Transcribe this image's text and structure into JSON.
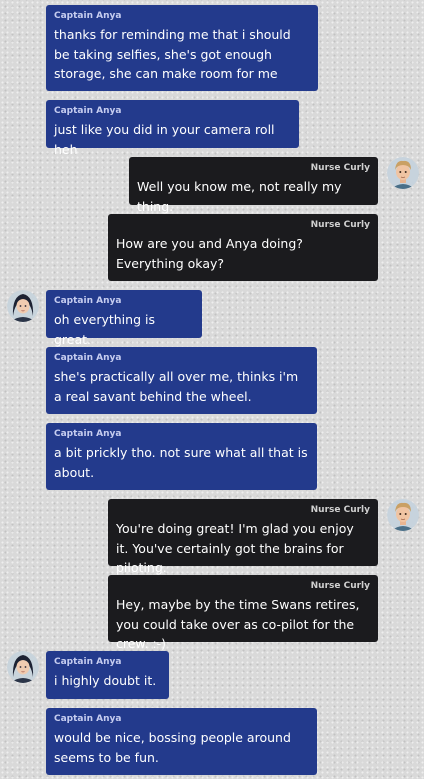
{
  "colors": {
    "anya_bubble": "#233a8c",
    "curly_bubble": "#1b1b1e",
    "background": "#d9d9d9"
  },
  "messages": [
    {
      "sender": "Captain Anya",
      "text": "thanks for reminding me that i should be taking selfies, she's got enough storage, she can make room for me"
    },
    {
      "sender": "Captain Anya",
      "text": "just like you did in your camera roll heh"
    },
    {
      "sender": "Nurse Curly",
      "text": "Well you know me, not really my thing."
    },
    {
      "sender": "Nurse Curly",
      "text": "How are you and Anya doing? Everything okay?"
    },
    {
      "sender": "Captain Anya",
      "text": "oh everything is great."
    },
    {
      "sender": "Captain Anya",
      "text": "she's practically all over me, thinks i'm a real savant behind the wheel."
    },
    {
      "sender": "Captain Anya",
      "text": "a bit prickly tho. not sure what all that is about."
    },
    {
      "sender": "Nurse Curly",
      "text": "You're doing great! I'm glad you enjoy it. You've certainly got the brains for piloting."
    },
    {
      "sender": "Nurse Curly",
      "text": "Hey, maybe by the time Swans retires, you could take over as co-pilot for the crew. :-)"
    },
    {
      "sender": "Captain Anya",
      "text": "i highly doubt it."
    },
    {
      "sender": "Captain Anya",
      "text": "would be nice, bossing people around seems to be fun."
    }
  ],
  "avatars": {
    "anya": "anya-avatar-icon",
    "curly": "curly-avatar-icon"
  }
}
